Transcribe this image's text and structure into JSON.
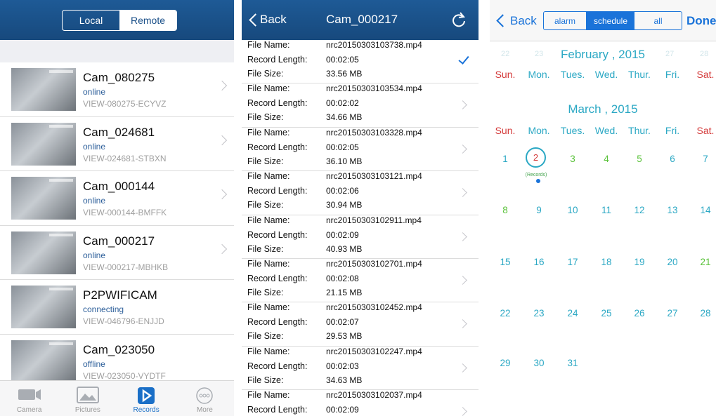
{
  "camera_list": {
    "segments": {
      "local": "Local",
      "remote": "Remote",
      "selected": "Remote"
    },
    "cameras": [
      {
        "name": "Cam_080275",
        "status": "online",
        "uid": "VIEW-080275-ECYVZ"
      },
      {
        "name": "Cam_024681",
        "status": "online",
        "uid": "VIEW-024681-STBXN"
      },
      {
        "name": "Cam_000144",
        "status": "online",
        "uid": "VIEW-000144-BMFFK"
      },
      {
        "name": "Cam_000217",
        "status": "online",
        "uid": "VIEW-000217-MBHKB"
      },
      {
        "name": "P2PWIFICAM",
        "status": "connecting",
        "uid": "VIEW-046796-ENJJD"
      },
      {
        "name": "Cam_023050",
        "status": "offline",
        "uid": "VIEW-023050-VYDTF"
      }
    ],
    "tabs": [
      {
        "label": "Camera",
        "icon": "camera-icon"
      },
      {
        "label": "Pictures",
        "icon": "pictures-icon"
      },
      {
        "label": "Records",
        "icon": "records-icon",
        "active": true
      },
      {
        "label": "More",
        "icon": "more-icon"
      }
    ]
  },
  "records": {
    "back": "Back",
    "title": "Cam_000217",
    "labels": {
      "file_name": "File Name:",
      "record_length": "Record Length:",
      "file_size": "File Size:"
    },
    "files": [
      {
        "name": "nrc20150303103738.mp4",
        "length": "00:02:05",
        "size": "33.56 MB",
        "checked": true
      },
      {
        "name": "nrc20150303103534.mp4",
        "length": "00:02:02",
        "size": "34.66 MB"
      },
      {
        "name": "nrc20150303103328.mp4",
        "length": "00:02:05",
        "size": "36.10 MB"
      },
      {
        "name": "nrc20150303103121.mp4",
        "length": "00:02:06",
        "size": "30.94 MB"
      },
      {
        "name": "nrc20150303102911.mp4",
        "length": "00:02:09",
        "size": "40.93 MB"
      },
      {
        "name": "nrc20150303102701.mp4",
        "length": "00:02:08",
        "size": "21.15 MB"
      },
      {
        "name": "nrc20150303102452.mp4",
        "length": "00:02:07",
        "size": "29.53 MB"
      },
      {
        "name": "nrc20150303102247.mp4",
        "length": "00:02:03",
        "size": "34.63 MB"
      },
      {
        "name": "nrc20150303102037.mp4",
        "length": "00:02:09",
        "size": ""
      }
    ]
  },
  "calendar": {
    "back": "Back",
    "segments": {
      "alarm": "alarm",
      "schedule": "schedule",
      "all": "all",
      "selected": "schedule"
    },
    "done": "Done",
    "prev_month": {
      "title": "February , 2015",
      "faded_days_left": [
        "22",
        "23"
      ],
      "faded_days_right": [
        "27",
        "28"
      ]
    },
    "weekdays": [
      "Sun.",
      "Mon.",
      "Tues.",
      "Wed.",
      "Thur.",
      "Fri.",
      "Sat."
    ],
    "month": {
      "title": "March , 2015",
      "weeks": [
        [
          "1",
          "2",
          "3",
          "4",
          "5",
          "6",
          "7"
        ],
        [
          "8",
          "9",
          "10",
          "11",
          "12",
          "13",
          "14"
        ],
        [
          "15",
          "16",
          "17",
          "18",
          "19",
          "20",
          "21"
        ],
        [
          "22",
          "23",
          "24",
          "25",
          "26",
          "27",
          "28"
        ],
        [
          "29",
          "30",
          "31"
        ]
      ],
      "green_days": [
        "3",
        "4",
        "5",
        "8",
        "21"
      ],
      "selected_day": "2",
      "selected_note": "(Records)"
    },
    "colors": {
      "accent": "#2ba8c4",
      "weekend": "#d43a3a",
      "highlight": "#5ac23a",
      "ios_blue": "#1a73d9"
    }
  }
}
